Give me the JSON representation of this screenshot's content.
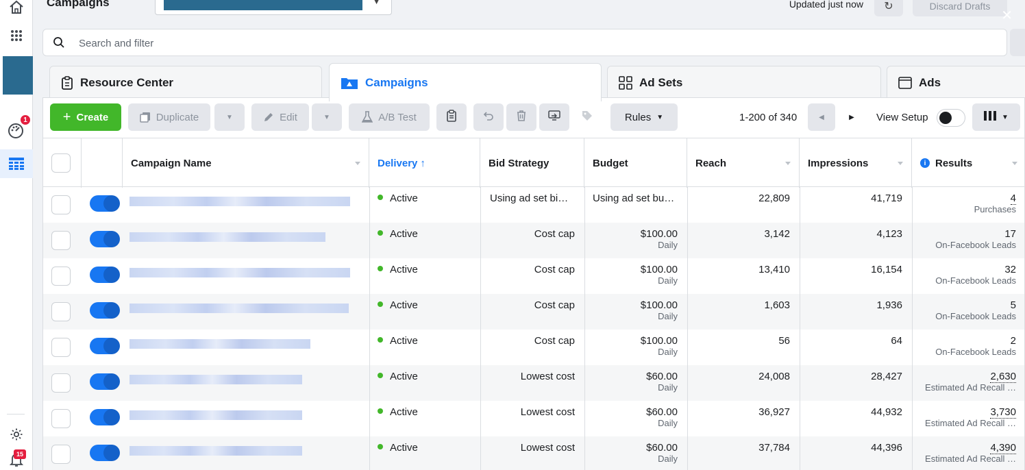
{
  "topbar": {
    "title": "Campaigns",
    "updated_text": "Updated just now",
    "discard_label": "Discard Drafts"
  },
  "rail": {
    "notifications_badge": "1",
    "alerts_badge": "15"
  },
  "search": {
    "placeholder": "Search and filter"
  },
  "tabs": [
    {
      "label": "Resource Center",
      "icon": "clipboard-icon"
    },
    {
      "label": "Campaigns",
      "icon": "folder-icon"
    },
    {
      "label": "Ad Sets",
      "icon": "grid-icon"
    },
    {
      "label": "Ads",
      "icon": "ad-icon"
    }
  ],
  "toolbar": {
    "create_label": "Create",
    "duplicate_label": "Duplicate",
    "edit_label": "Edit",
    "ab_test_label": "A/B Test",
    "rules_label": "Rules",
    "pager_text": "1-200 of 340",
    "view_setup_label": "View Setup"
  },
  "table": {
    "headers": {
      "campaign_name": "Campaign Name",
      "delivery": "Delivery",
      "bid_strategy": "Bid Strategy",
      "budget": "Budget",
      "reach": "Reach",
      "impressions": "Impressions",
      "results": "Results"
    },
    "rows": [
      {
        "delivery": "Active",
        "bid": "Using ad set bi…",
        "budget": "Using ad set bu…",
        "budget_sub": "",
        "reach": "22,809",
        "impressions": "41,719",
        "results": "4",
        "results_sub": "Purchases"
      },
      {
        "delivery": "Active",
        "bid": "Cost cap",
        "budget": "$100.00",
        "budget_sub": "Daily",
        "reach": "3,142",
        "impressions": "4,123",
        "results": "17",
        "results_sub": "On-Facebook Leads"
      },
      {
        "delivery": "Active",
        "bid": "Cost cap",
        "budget": "$100.00",
        "budget_sub": "Daily",
        "reach": "13,410",
        "impressions": "16,154",
        "results": "32",
        "results_sub": "On-Facebook Leads"
      },
      {
        "delivery": "Active",
        "bid": "Cost cap",
        "budget": "$100.00",
        "budget_sub": "Daily",
        "reach": "1,603",
        "impressions": "1,936",
        "results": "5",
        "results_sub": "On-Facebook Leads"
      },
      {
        "delivery": "Active",
        "bid": "Cost cap",
        "budget": "$100.00",
        "budget_sub": "Daily",
        "reach": "56",
        "impressions": "64",
        "results": "2",
        "results_sub": "On-Facebook Leads"
      },
      {
        "delivery": "Active",
        "bid": "Lowest cost",
        "budget": "$60.00",
        "budget_sub": "Daily",
        "reach": "24,008",
        "impressions": "28,427",
        "results": "2,630",
        "results_sub": "Estimated Ad Recall …"
      },
      {
        "delivery": "Active",
        "bid": "Lowest cost",
        "budget": "$60.00",
        "budget_sub": "Daily",
        "reach": "36,927",
        "impressions": "44,932",
        "results": "3,730",
        "results_sub": "Estimated Ad Recall …"
      },
      {
        "delivery": "Active",
        "bid": "Lowest cost",
        "budget": "$60.00",
        "budget_sub": "Daily",
        "reach": "37,784",
        "impressions": "44,396",
        "results": "4,390",
        "results_sub": "Estimated Ad Recall …"
      }
    ]
  }
}
